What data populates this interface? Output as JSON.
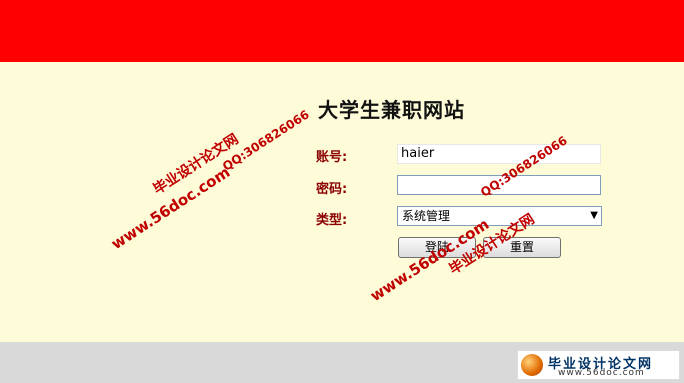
{
  "site": {
    "title": "大学生兼职网站"
  },
  "form": {
    "account_label": "账号:",
    "account_value": "haier",
    "password_label": "密码:",
    "password_value": "",
    "type_label": "类型:",
    "type_selected": "系统管理",
    "login_button": "登陆",
    "reset_button": "重置"
  },
  "watermarks": {
    "site_url": "www.56doc.com",
    "site_name": "毕业设计论文网",
    "qq": "QQ:306826066"
  },
  "footer_logo": {
    "name": "毕业设计论文网",
    "url": "www.56doc.com"
  },
  "colors": {
    "banner": "#ff0000",
    "background": "#fdfbd8",
    "footer": "#d9d9d9",
    "label": "#8b0000",
    "watermark": "#c00000"
  }
}
